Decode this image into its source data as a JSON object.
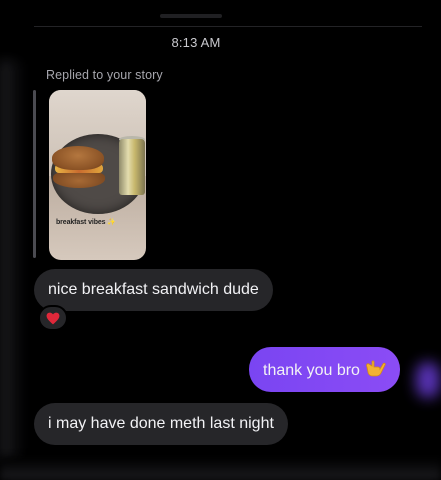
{
  "conversation": {
    "timestamp": "8:13 AM",
    "reply_context": {
      "label": "Replied to your story",
      "story_caption": "breakfast vibes"
    },
    "messages": [
      {
        "direction": "incoming",
        "text": "nice breakfast sandwich dude",
        "reaction": "heart"
      },
      {
        "direction": "outgoing",
        "text": "thank you bro",
        "emoji": "call-me-hand"
      },
      {
        "direction": "incoming",
        "text": "i may have done meth last night"
      }
    ]
  },
  "colors": {
    "background": "#000000",
    "incoming_bubble": "#262629",
    "outgoing_bubble": "#7a45f2",
    "reaction_heart": "#e0283a"
  }
}
